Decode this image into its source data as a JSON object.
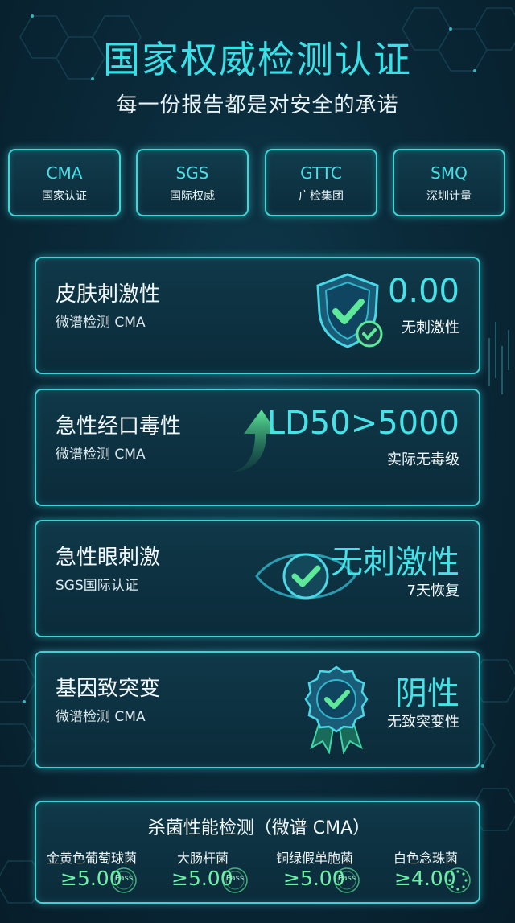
{
  "header": {
    "title": "国家权威检测认证",
    "subtitle": "每一份报告都是对安全的承诺"
  },
  "certs": [
    {
      "name": "CMA",
      "org": "国家认证"
    },
    {
      "name": "SGS",
      "org": "国际权威"
    },
    {
      "name": "GTTC",
      "org": "广检集团"
    },
    {
      "name": "SMQ",
      "org": "深圳计量"
    }
  ],
  "tests": [
    {
      "name": "皮肤刺激性",
      "standard": "微谱检测 CMA",
      "value": "0.00",
      "note": "无刺激性",
      "icon": "shield-check-icon"
    },
    {
      "name": "急性经口毒性",
      "standard": "微谱检测 CMA",
      "value": "LD50>5000",
      "note": "实际无毒级",
      "icon": "arrow-up-icon"
    },
    {
      "name": "急性眼刺激",
      "standard": "SGS国际认证",
      "value": "无刺激性",
      "note": "7天恢复",
      "icon": "eye-check-icon"
    },
    {
      "name": "基因致突变",
      "standard": "微谱检测 CMA",
      "value": "阴性",
      "note": "无致突变性",
      "icon": "badge-check-icon"
    }
  ],
  "antibacterial": {
    "title": "杀菌性能检测（微谱 CMA）",
    "items": [
      {
        "name": "金黄色葡萄球菌",
        "value": "≥5.00",
        "stamp": "Pass"
      },
      {
        "name": "大肠杆菌",
        "value": "≥5.00",
        "stamp": "Pass"
      },
      {
        "name": "铜绿假单胞菌",
        "value": "≥5.00",
        "stamp": "Pass"
      },
      {
        "name": "白色念珠菌",
        "value": "≥4.00",
        "stamp": ""
      }
    ]
  },
  "colors": {
    "accent": "#38e0e8",
    "success": "#5ee89a",
    "border": "#42d0d6",
    "background": "#0a2a3a"
  }
}
